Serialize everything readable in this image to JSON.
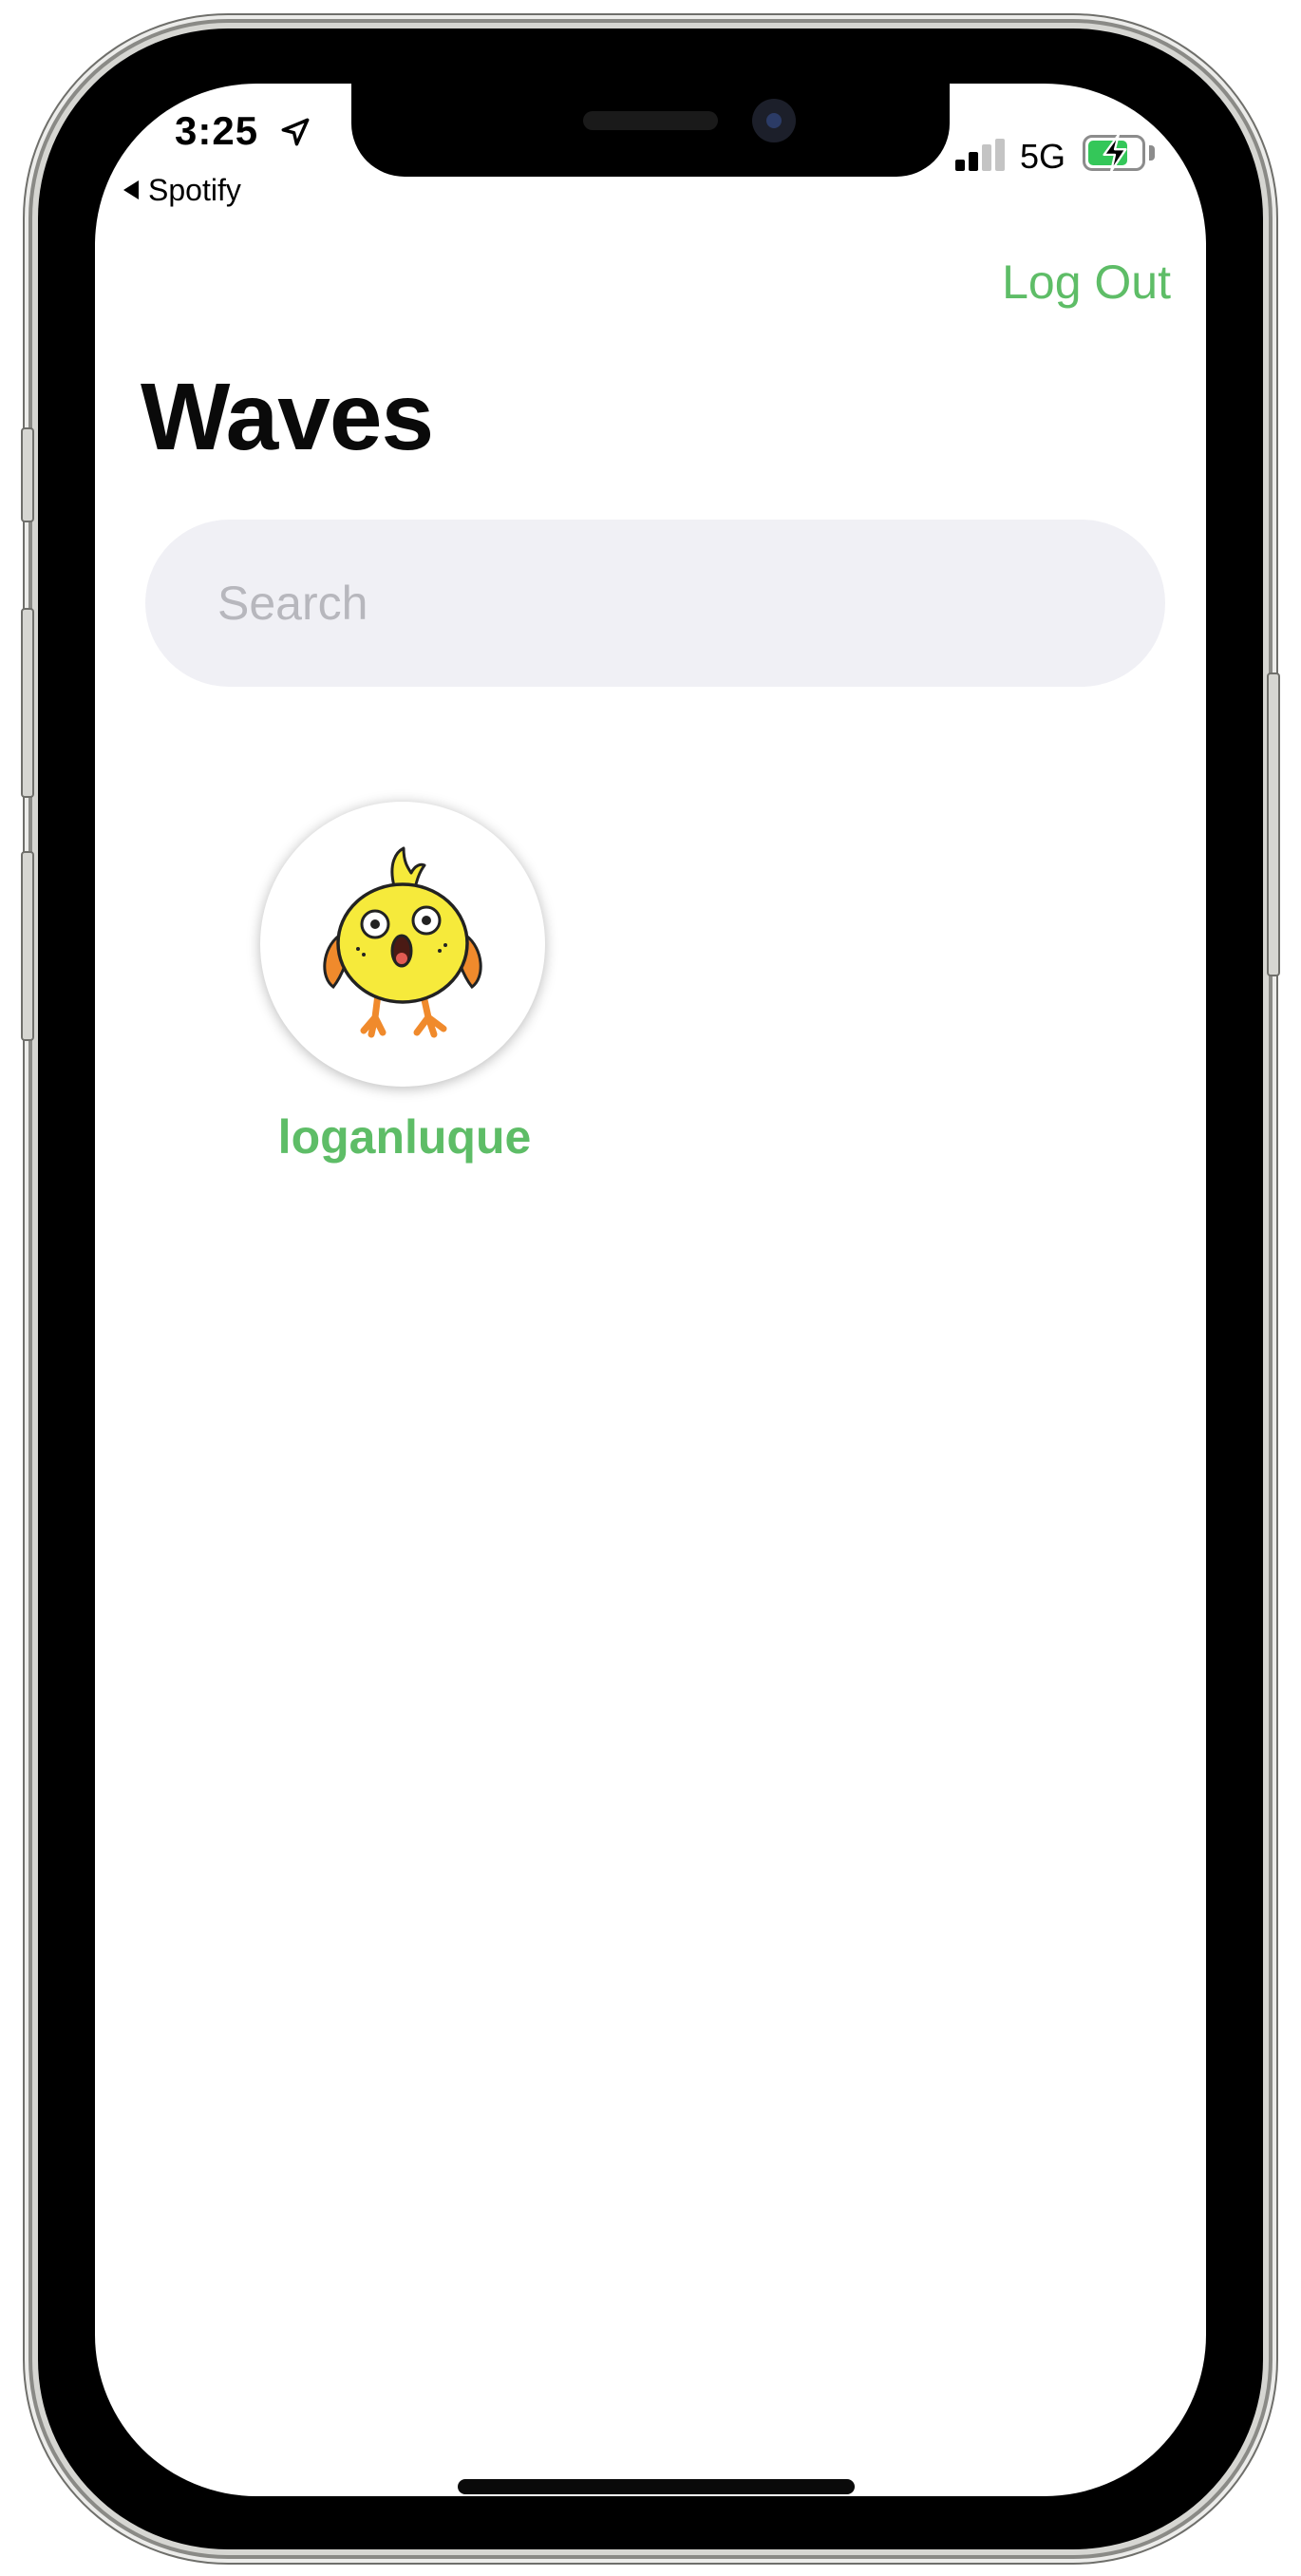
{
  "status_bar": {
    "time": "3:25",
    "back_app": "Spotify",
    "network": "5G",
    "battery_level": 0.75,
    "signal_bars_active": 2
  },
  "header": {
    "logout_label": "Log Out",
    "title": "Waves"
  },
  "search": {
    "placeholder": "Search",
    "value": ""
  },
  "users": [
    {
      "username": "loganluque",
      "avatar_icon": "yellow-chick-icon"
    }
  ],
  "colors": {
    "accent": "#5ebd67",
    "search_bg": "#f0f0f5",
    "placeholder": "#b7b7bd",
    "chick_yellow": "#f6ea3b",
    "chick_orange": "#f08a2c"
  }
}
